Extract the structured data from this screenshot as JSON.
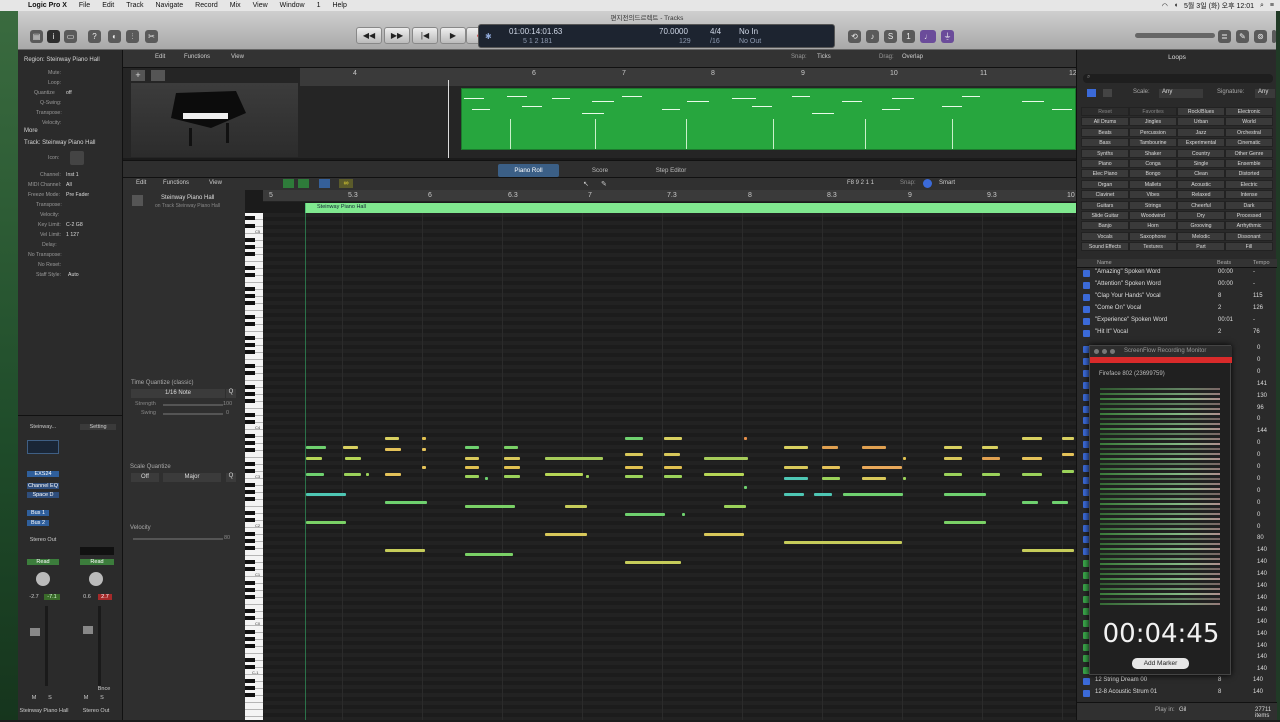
{
  "menubar": {
    "app": "Logic Pro X",
    "items": [
      "File",
      "Edit",
      "Track",
      "Navigate",
      "Record",
      "Mix",
      "View",
      "Window",
      "1",
      "Help"
    ],
    "clock": "5월 3일 (화) 오후 12:01"
  },
  "window": {
    "title": "편지전의드르렉트 - Tracks"
  },
  "lcd": {
    "position_time": "01:00:14:01.63",
    "position_bars": "5  1  2  181",
    "tempo": "70.0000",
    "tempo_sub": "129",
    "sig": "4/4",
    "sig_sub": "/16",
    "in": "No In",
    "out": "No Out"
  },
  "inspector": {
    "region_header": "Region: Steinway Piano Hall",
    "rows": [
      {
        "k": "Mute:",
        "v": ""
      },
      {
        "k": "Loop:",
        "v": ""
      },
      {
        "k": "Quantize",
        "v": "off"
      },
      {
        "k": "Q-Swing:",
        "v": ""
      },
      {
        "k": "Transpose:",
        "v": ""
      },
      {
        "k": "Velocity:",
        "v": ""
      }
    ],
    "more": "More",
    "track_header": "Track: Steinway Piano Hall",
    "track_rows": [
      {
        "k": "Icon:",
        "v": ""
      },
      {
        "k": "Channel:",
        "v": "Inst 1"
      },
      {
        "k": "MIDI Channel:",
        "v": "All"
      },
      {
        "k": "Freeze Mode:",
        "v": "Pre Fader"
      },
      {
        "k": "Transpose:",
        "v": ""
      },
      {
        "k": "Velocity:",
        "v": ""
      },
      {
        "k": "Key Limit:",
        "v": "C-2   G8"
      },
      {
        "k": "Vel Limit:",
        "v": "1   127"
      },
      {
        "k": "Delay:",
        "v": ""
      },
      {
        "k": "No Transpose:",
        "v": ""
      },
      {
        "k": "No Reset:",
        "v": ""
      },
      {
        "k": "Staff Style:",
        "v": "Auto"
      }
    ],
    "strips": {
      "strip1_name": "Steinway Piano Hall",
      "strip2_name": "Stereo Out",
      "strip1_plugin": "Steinway...",
      "strip1_setting": "Setting",
      "strip1_exs": "EXS24",
      "strip1_eq": "Channel EQ",
      "strip1_space": "Space D",
      "bus1": "Bus 1",
      "bus2": "Bus 2",
      "stereo_out": "Stereo Out",
      "read1": "Read",
      "read2": "Read",
      "db1a": "-2.7",
      "db1b": "-7.1",
      "db2a": "0.6",
      "db2b": "2.7",
      "bnce": "Bnce",
      "m": "M",
      "s": "S"
    }
  },
  "tracks_header": {
    "edit": "Edit",
    "functions": "Functions",
    "view": "View",
    "snap_label": "Snap:",
    "snap": "Ticks",
    "drag_label": "Drag:",
    "drag": "Overlap"
  },
  "ruler_top": [
    "4",
    "5",
    "6",
    "7",
    "8",
    "9",
    "10",
    "11",
    "12"
  ],
  "editor": {
    "tabs": [
      "Piano Roll",
      "Score",
      "Step Editor"
    ],
    "edit": "Edit",
    "functions": "Functions",
    "view": "View",
    "pos": "F8  9 2 1 1",
    "snap_label": "Snap:",
    "snap": "Smart",
    "track_name": "Steinway Piano Hall",
    "track_sub": "on Track Steinway Piano Hall",
    "region_name": "Steinway Piano Hall",
    "ruler": [
      "5",
      "5.3",
      "6",
      "6.3",
      "7",
      "7.3",
      "8",
      "8.3",
      "9",
      "9.3",
      "10"
    ],
    "time_quantize_label": "Time Quantize (classic)",
    "time_quantize_value": "1/16 Note",
    "strength_label": "Strength",
    "strength_value": "100",
    "swing_label": "Swing",
    "swing_value": "0",
    "scale_quantize_label": "Scale Quantize",
    "scale_off": "Off",
    "scale_mode": "Major",
    "velocity_label": "Velocity",
    "velocity_value": "80",
    "octaves": [
      "C5",
      "C4",
      "C3",
      "C2",
      "C1",
      "C0",
      "C-1"
    ]
  },
  "loops": {
    "title": "Loops",
    "scale_label": "Scale:",
    "scale": "Any",
    "sig_label": "Signature:",
    "sig": "Any",
    "keywords": [
      "Reset",
      "Favorites",
      "Rock/Blues",
      "Electronic",
      "All Drums",
      "Jingles",
      "Urban",
      "World",
      "Beats",
      "Percussion",
      "Jazz",
      "Orchestral",
      "Bass",
      "Tambourine",
      "Experimental",
      "Cinematic",
      "Synths",
      "Shaker",
      "Country",
      "Other Genre",
      "Piano",
      "Conga",
      "Single",
      "Ensemble",
      "Elec Piano",
      "Bongo",
      "Clean",
      "Distorted",
      "Organ",
      "Mallets",
      "Acoustic",
      "Electric",
      "Clavinet",
      "Vibes",
      "Relaxed",
      "Intense",
      "Guitars",
      "Strings",
      "Cheerful",
      "Dark",
      "Slide Guitar",
      "Woodwind",
      "Dry",
      "Processed",
      "Banjo",
      "Horn",
      "Grooving",
      "Arrhythmic",
      "Vocals",
      "Saxophone",
      "Melodic",
      "Dissonant",
      "Sound Effects",
      "Textures",
      "Part",
      "Fill"
    ],
    "col_name": "Name",
    "col_beats": "Beats",
    "col_tempo": "Tempo",
    "rows": [
      {
        "name": "\"Amazing\" Spoken Word",
        "beats": "00:00",
        "tempo": "-"
      },
      {
        "name": "\"Attention\" Spoken Word",
        "beats": "00:00",
        "tempo": "-"
      },
      {
        "name": "\"Clap Your Hands\" Vocal",
        "beats": "8",
        "tempo": "115"
      },
      {
        "name": "\"Come On\" Vocal",
        "beats": "2",
        "tempo": "126"
      },
      {
        "name": "\"Experience\" Spoken Word",
        "beats": "00:01",
        "tempo": "-"
      },
      {
        "name": "\"Hit It\" Vocal",
        "beats": "2",
        "tempo": "76"
      },
      {
        "name": "12 String Dream 00",
        "beats": "8",
        "tempo": "140"
      },
      {
        "name": "12-8 Acoustic Strum 01",
        "beats": "8",
        "tempo": "140"
      }
    ],
    "right_values": [
      "0",
      "0",
      "0",
      "141",
      "130",
      "96",
      "0",
      "144",
      "0",
      "0",
      "0",
      "0",
      "0",
      "0",
      "0",
      "0",
      "80",
      "140",
      "140",
      "140",
      "140",
      "140",
      "140",
      "140",
      "140",
      "140",
      "140",
      "140"
    ],
    "play_in_label": "Play in:",
    "play_in": "Gil",
    "count": "27711 items"
  },
  "screenflow": {
    "title": "ScreenFlow Recording Monitor",
    "device": "Fireface 802 (23699759)",
    "time": "00:04:45",
    "add_marker": "Add Marker"
  },
  "colors": {
    "region_green": "#27a63e",
    "lcd_bg": "#1d2430",
    "record_red": "#d92a2a"
  }
}
